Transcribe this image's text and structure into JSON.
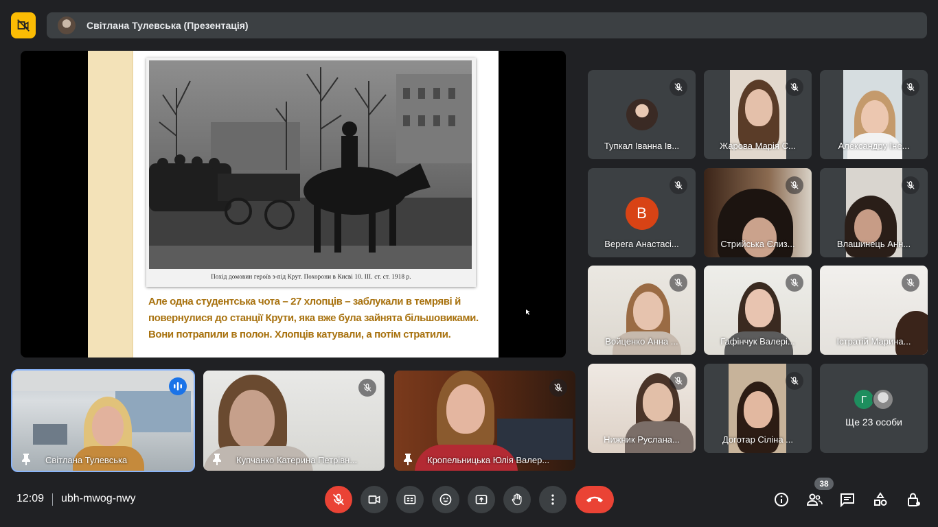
{
  "presenter_bar": {
    "name": "Світлана Тулевська (Презентація)"
  },
  "slide": {
    "photo_caption": "Похід домовин героїв з-під Крут. Похорони в Києві 10. III. ст. ст. 1918 р.",
    "text": "Але одна студентська чота – 27 хлопців – заблукали в темряві й повернулися до станції Крути, яка вже була зайнята більшовиками. Вони потрапили в полон. Хлопців катували, а потім стратили."
  },
  "bottom_tiles": [
    {
      "name": "Світлана Тулевська",
      "active": true
    },
    {
      "name": "Купчанко Катерина Петрівн..."
    },
    {
      "name": "Кропельницька Юлія Валер..."
    }
  ],
  "grid": [
    {
      "name": "Тупкал Іванна Ів..."
    },
    {
      "name": "Жарова Марія С..."
    },
    {
      "name": "Александру Іне..."
    },
    {
      "name": "Верега Анастасі...",
      "avatar_letter": "В"
    },
    {
      "name": "Стрийська Єлиз..."
    },
    {
      "name": "Влашинець Анн..."
    },
    {
      "name": "Войценко Анна ..."
    },
    {
      "name": "Гафінчук Валері..."
    },
    {
      "name": "Істратій Марина..."
    },
    {
      "name": "Нижник Руслана..."
    },
    {
      "name": "Доготар Сіліна ..."
    }
  ],
  "others": {
    "letter": "Г",
    "label": "Ще 23 особи"
  },
  "footer": {
    "time": "12:09",
    "meeting_code": "ubh-mwog-nwy",
    "participants_count": "38"
  },
  "colors": {
    "background": "#202124",
    "tile": "#3c4043",
    "accent_yellow": "#fbbc04",
    "danger_red": "#ea4335",
    "active_outline": "#8ab4f8",
    "slide_text": "#a8720f"
  }
}
